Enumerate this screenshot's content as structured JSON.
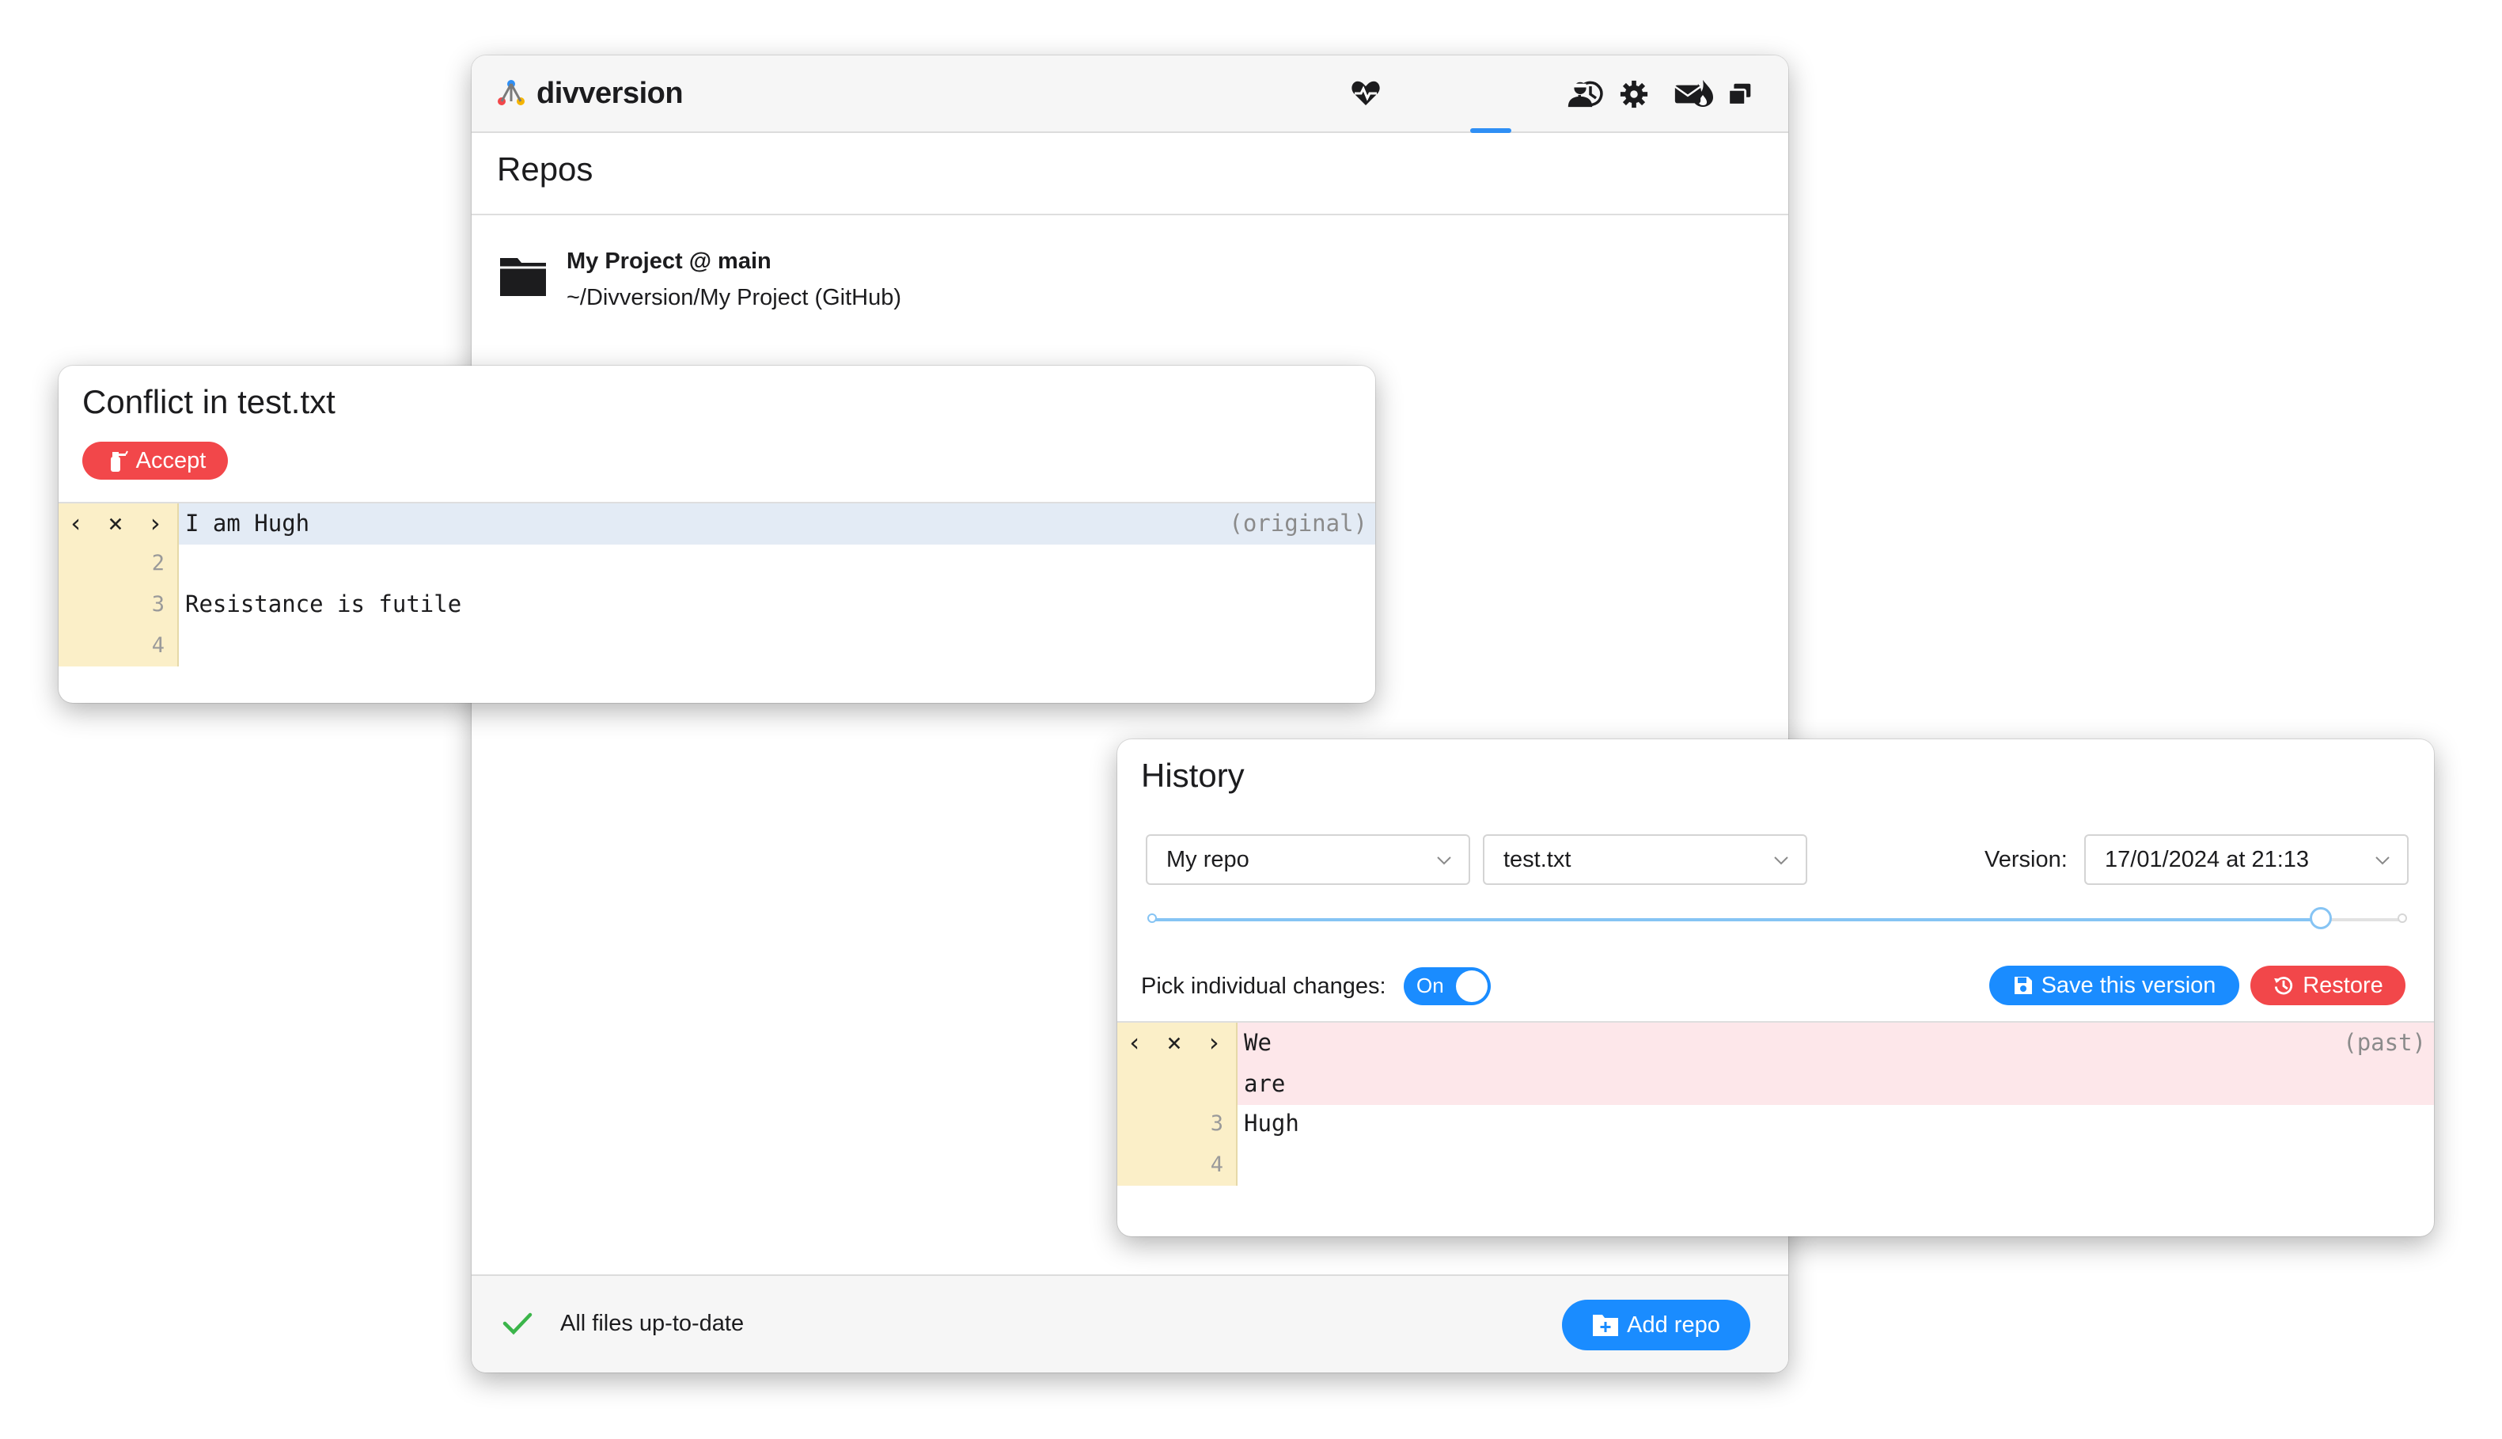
{
  "app": {
    "name": "divversion",
    "nav_icons": [
      "heart-pulse-icon",
      "folder-icon",
      "history-icon",
      "flame-icon",
      "merge-icon"
    ],
    "right_icons": [
      "user-icon",
      "gear-icon",
      "mail-icon",
      "windows-icon"
    ],
    "page_title": "Repos",
    "repos": [
      {
        "name": "My Project @ main",
        "path": "~/Divversion/My Project (GitHub)"
      }
    ],
    "footer": {
      "status": "All files up-to-date",
      "add_repo_label": "Add repo"
    },
    "colors": {
      "accent": "#1a8cff",
      "danger": "#f2474a",
      "success": "#3bb54a"
    }
  },
  "conflict": {
    "title": "Conflict in test.txt",
    "accept_label": "Accept",
    "lines": [
      {
        "num": "",
        "text": "I am Hugh",
        "tag": "(original)"
      },
      {
        "num": "2",
        "text": "",
        "tag": ""
      },
      {
        "num": "3",
        "text": "Resistance is futile",
        "tag": ""
      },
      {
        "num": "4",
        "text": "",
        "tag": ""
      }
    ]
  },
  "history": {
    "title": "History",
    "repo_select": "My repo",
    "file_select": "test.txt",
    "version_label": "Version:",
    "version_select": "17/01/2024 at 21:13",
    "slider_fraction": 0.935,
    "pick_label": "Pick individual changes:",
    "toggle_label": "On",
    "save_label": "Save this version",
    "restore_label": "Restore",
    "lines": [
      {
        "num": "",
        "text": "We",
        "tag": "(past)"
      },
      {
        "num": "",
        "text": "are",
        "tag": ""
      },
      {
        "num": "3",
        "text": "Hugh",
        "tag": ""
      },
      {
        "num": "4",
        "text": "",
        "tag": ""
      }
    ]
  }
}
